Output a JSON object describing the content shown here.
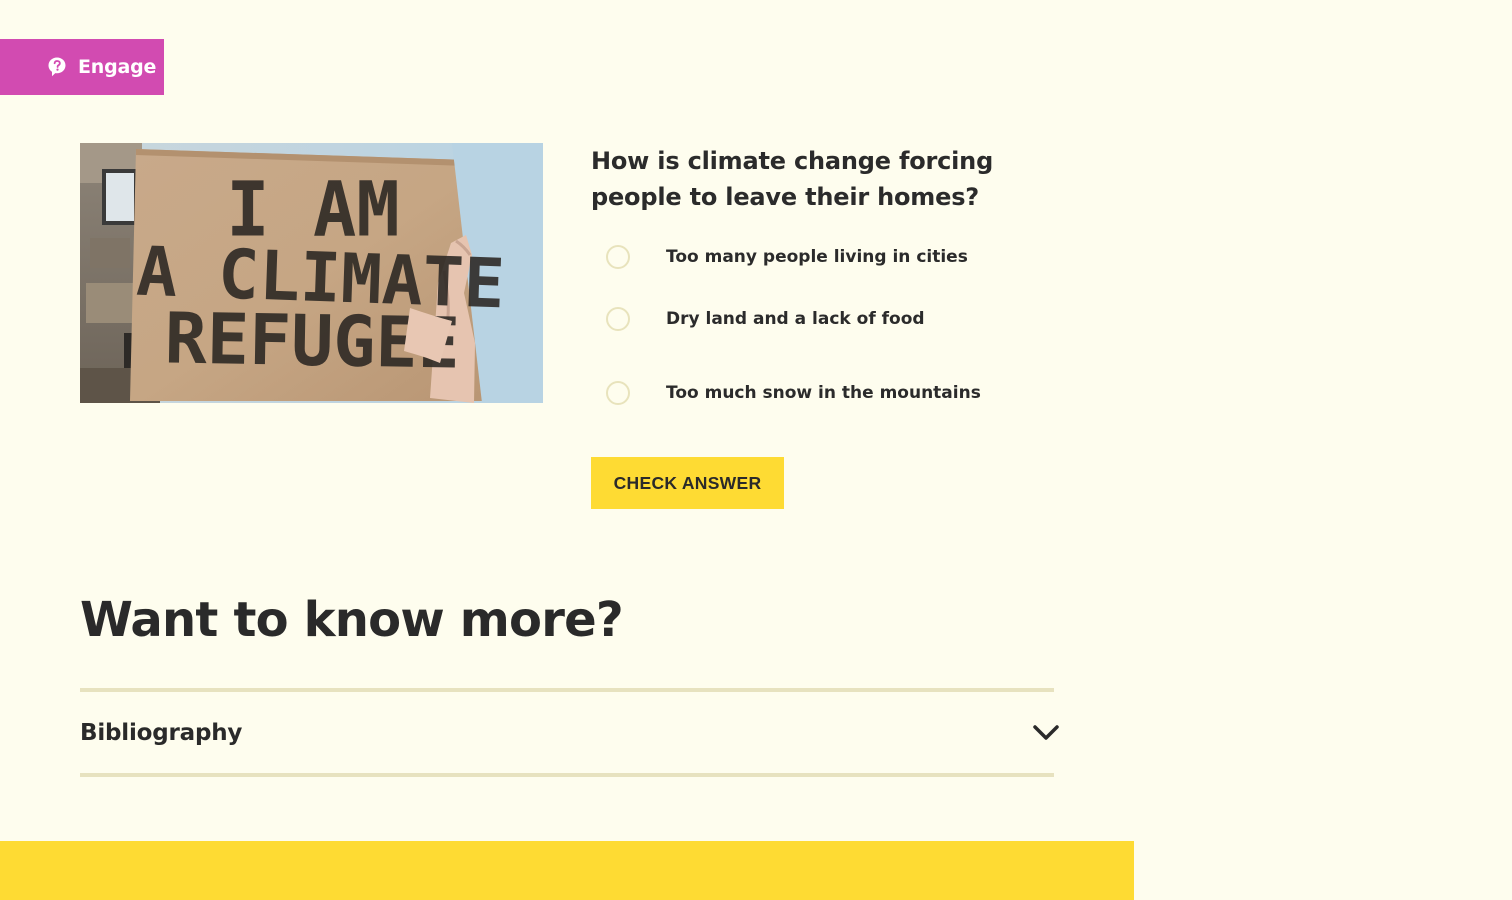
{
  "engage_tag": {
    "label": "Engage",
    "icon": "question-bubble-icon",
    "color": "#d24bb1"
  },
  "photo": {
    "sign_lines": [
      "I AM",
      "A CLIMATE",
      "REFUGEE"
    ]
  },
  "quiz": {
    "question": "How is climate change forcing people to leave their homes?",
    "options": [
      {
        "label": "Too many people living in cities",
        "selected": false
      },
      {
        "label": "Dry land and a lack of food",
        "selected": false
      },
      {
        "label": "Too much snow in the mountains",
        "selected": false
      }
    ],
    "check_button_label": "CHECK ANSWER"
  },
  "more": {
    "title": "Want to know more?",
    "accordion": {
      "label": "Bibliography",
      "expanded": false,
      "icon": "chevron-down-icon"
    }
  },
  "colors": {
    "background": "#fefdee",
    "accent_yellow": "#fedb33",
    "engage_magenta": "#d24bb1",
    "divider": "#e7e2bf"
  }
}
